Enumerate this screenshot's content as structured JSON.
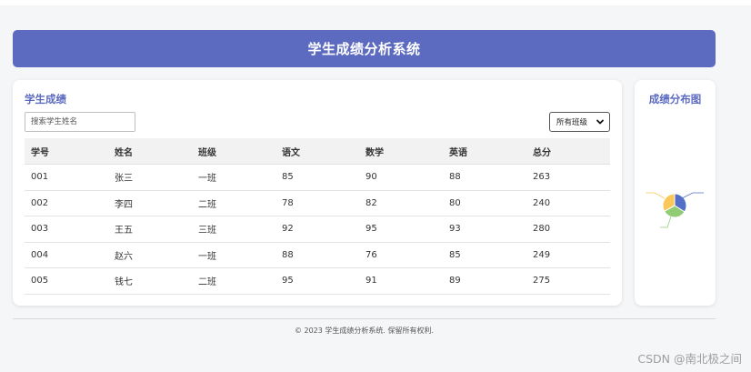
{
  "header": {
    "title": "学生成绩分析系统"
  },
  "students_panel": {
    "title": "学生成绩",
    "search_placeholder": "搜索学生姓名",
    "class_filter": "所有班级",
    "columns": [
      "学号",
      "姓名",
      "班级",
      "语文",
      "数学",
      "英语",
      "总分"
    ],
    "rows": [
      [
        "001",
        "张三",
        "一班",
        "85",
        "90",
        "88",
        "263"
      ],
      [
        "002",
        "李四",
        "二班",
        "78",
        "82",
        "80",
        "240"
      ],
      [
        "003",
        "王五",
        "三班",
        "92",
        "95",
        "93",
        "280"
      ],
      [
        "004",
        "赵六",
        "一班",
        "88",
        "76",
        "85",
        "249"
      ],
      [
        "005",
        "钱七",
        "二班",
        "95",
        "91",
        "89",
        "275"
      ]
    ]
  },
  "distribution_panel": {
    "title": "成绩分布图"
  },
  "chart_data": {
    "type": "pie",
    "slices": [
      {
        "share": 0.34,
        "color": "#5470c6"
      },
      {
        "share": 0.33,
        "color": "#91cc75"
      },
      {
        "share": 0.33,
        "color": "#fac858"
      }
    ]
  },
  "footer": {
    "text": "© 2023 学生成绩分析系统. 保留所有权利."
  },
  "watermark": "CSDN @南北极之间",
  "colors": {
    "accent": "#5c6bc0",
    "background": "#f5f6f8"
  }
}
